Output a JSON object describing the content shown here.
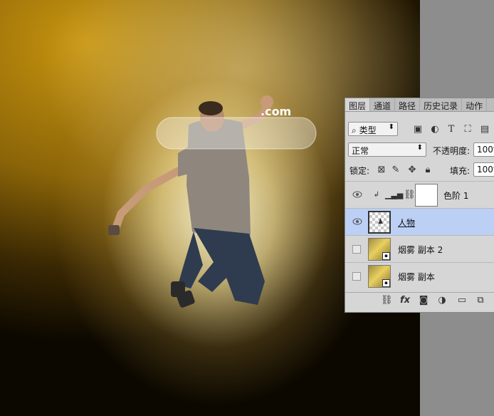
{
  "panel": {
    "tabs": [
      "图层",
      "通道",
      "路径",
      "历史记录",
      "动作"
    ],
    "active_tab": "图层",
    "filter": {
      "icon": "search-icon",
      "label": "类型"
    },
    "blend_mode": "正常",
    "opacity": {
      "label": "不透明度:",
      "value": "100%"
    },
    "lock": {
      "label": "锁定:"
    },
    "fill": {
      "label": "填充:",
      "value": "100%"
    },
    "layers": [
      {
        "name": "色阶 1",
        "type": "adjustment",
        "visible": true,
        "selected": false
      },
      {
        "name": "人物",
        "type": "pixel",
        "visible": true,
        "selected": true
      },
      {
        "name": "烟雾 副本 2",
        "type": "smart-object",
        "visible": false,
        "selected": false
      },
      {
        "name": "烟雾 副本",
        "type": "smart-object",
        "visible": false,
        "selected": false
      }
    ]
  },
  "canvas": {
    "watermark_text": ".com",
    "colors": {
      "background_gold": "#c8950f",
      "glow": "#fff6d0",
      "panel_bg": "#d6d6d6",
      "selected_row": "#bcd0f5"
    }
  }
}
